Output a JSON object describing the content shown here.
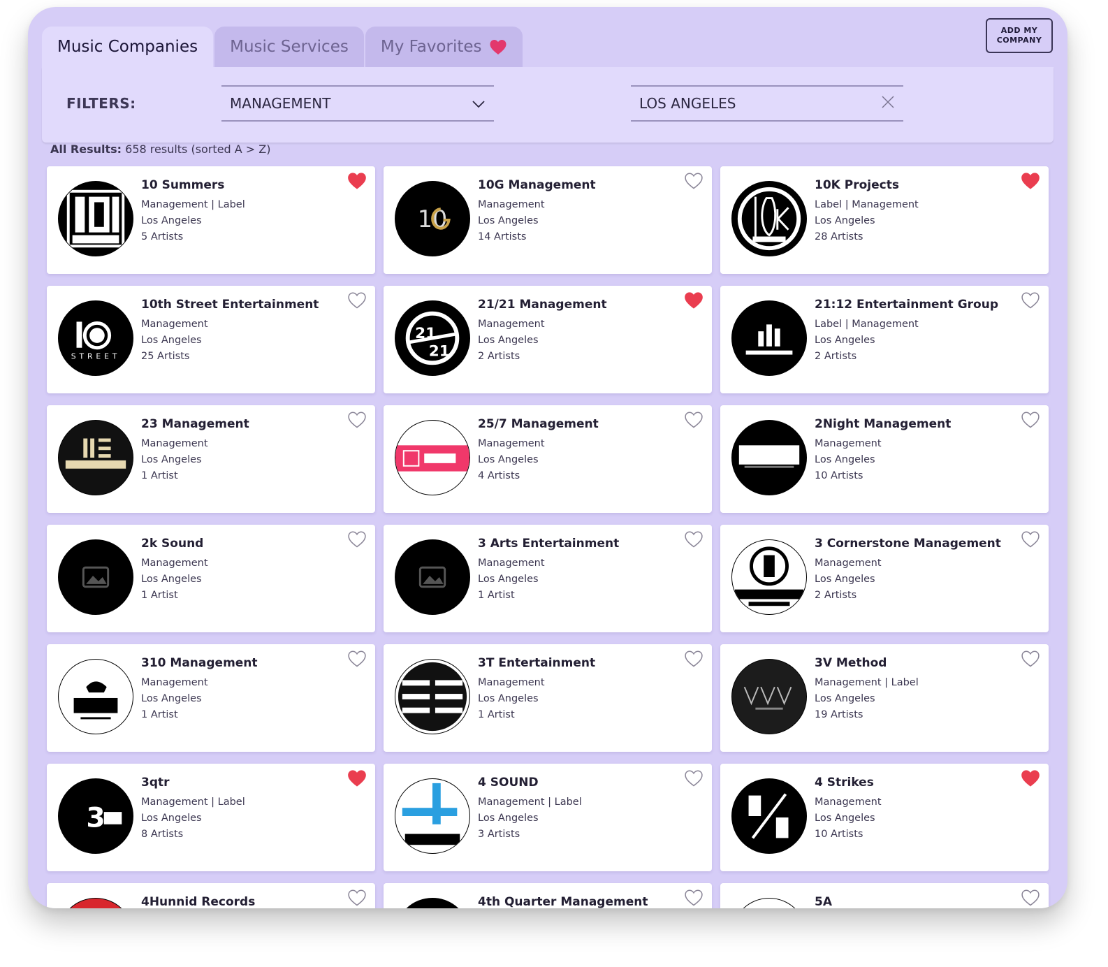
{
  "tabs": [
    {
      "label": "Music Companies",
      "active": true
    },
    {
      "label": "Music Services",
      "active": false
    },
    {
      "label": "My Favorites",
      "active": false,
      "icon": "heart-icon"
    }
  ],
  "add_button": "ADD MY\nCOMPANY",
  "filters": {
    "label": "FILTERS:",
    "category": {
      "value": "MANAGEMENT",
      "icon": "chevron-down-icon"
    },
    "location": {
      "value": "LOS ANGELES",
      "icon": "close-icon"
    }
  },
  "results": {
    "label": "All Results:",
    "text": "658 results (sorted A > Z)"
  },
  "colors": {
    "favorite": "#ea3d4f",
    "tab_heart": "#e3386d",
    "frame": "#d6cdf7",
    "filter_bar": "#e1dafc"
  },
  "companies": [
    {
      "name": "10 Summers",
      "type": "Management | Label",
      "city": "Los Angeles",
      "artists": "5 Artists",
      "favorite": true
    },
    {
      "name": "10G Management",
      "type": "Management",
      "city": "Los Angeles",
      "artists": "14 Artists",
      "favorite": false
    },
    {
      "name": "10K Projects",
      "type": "Label | Management",
      "city": "Los Angeles",
      "artists": "28 Artists",
      "favorite": true
    },
    {
      "name": "10th Street Entertainment",
      "type": "Management",
      "city": "Los Angeles",
      "artists": "25 Artists",
      "favorite": false
    },
    {
      "name": "21/21 Management",
      "type": "Management",
      "city": "Los Angeles",
      "artists": "2 Artists",
      "favorite": true
    },
    {
      "name": "21:12 Entertainment Group",
      "type": "Label | Management",
      "city": "Los Angeles",
      "artists": "2 Artists",
      "favorite": false
    },
    {
      "name": "23 Management",
      "type": "Management",
      "city": "Los Angeles",
      "artists": "1 Artist",
      "favorite": false
    },
    {
      "name": "25/7 Management",
      "type": "Management",
      "city": "Los Angeles",
      "artists": "4 Artists",
      "favorite": false
    },
    {
      "name": "2Night Management",
      "type": "Management",
      "city": "Los Angeles",
      "artists": "10 Artists",
      "favorite": false
    },
    {
      "name": "2k Sound",
      "type": "Management",
      "city": "Los Angeles",
      "artists": "1 Artist",
      "favorite": false
    },
    {
      "name": "3 Arts Entertainment",
      "type": "Management",
      "city": "Los Angeles",
      "artists": "1 Artist",
      "favorite": false
    },
    {
      "name": "3 Cornerstone Management",
      "type": "Management",
      "city": "Los Angeles",
      "artists": "2 Artists",
      "favorite": false
    },
    {
      "name": "310 Management",
      "type": "Management",
      "city": "Los Angeles",
      "artists": "1 Artist",
      "favorite": false
    },
    {
      "name": "3T Entertainment",
      "type": "Management",
      "city": "Los Angeles",
      "artists": "1 Artist",
      "favorite": false
    },
    {
      "name": "3V Method",
      "type": "Management | Label",
      "city": "Los Angeles",
      "artists": "19 Artists",
      "favorite": false
    },
    {
      "name": "3qtr",
      "type": "Management | Label",
      "city": "Los Angeles",
      "artists": "8 Artists",
      "favorite": true
    },
    {
      "name": "4 SOUND",
      "type": "Management | Label",
      "city": "Los Angeles",
      "artists": "3 Artists",
      "favorite": false
    },
    {
      "name": "4 Strikes",
      "type": "Management",
      "city": "Los Angeles",
      "artists": "10 Artists",
      "favorite": true
    },
    {
      "name": "4Hunnid Records",
      "favorite": false
    },
    {
      "name": "4th Quarter Management",
      "favorite": false
    },
    {
      "name": "5A",
      "favorite": false
    }
  ]
}
